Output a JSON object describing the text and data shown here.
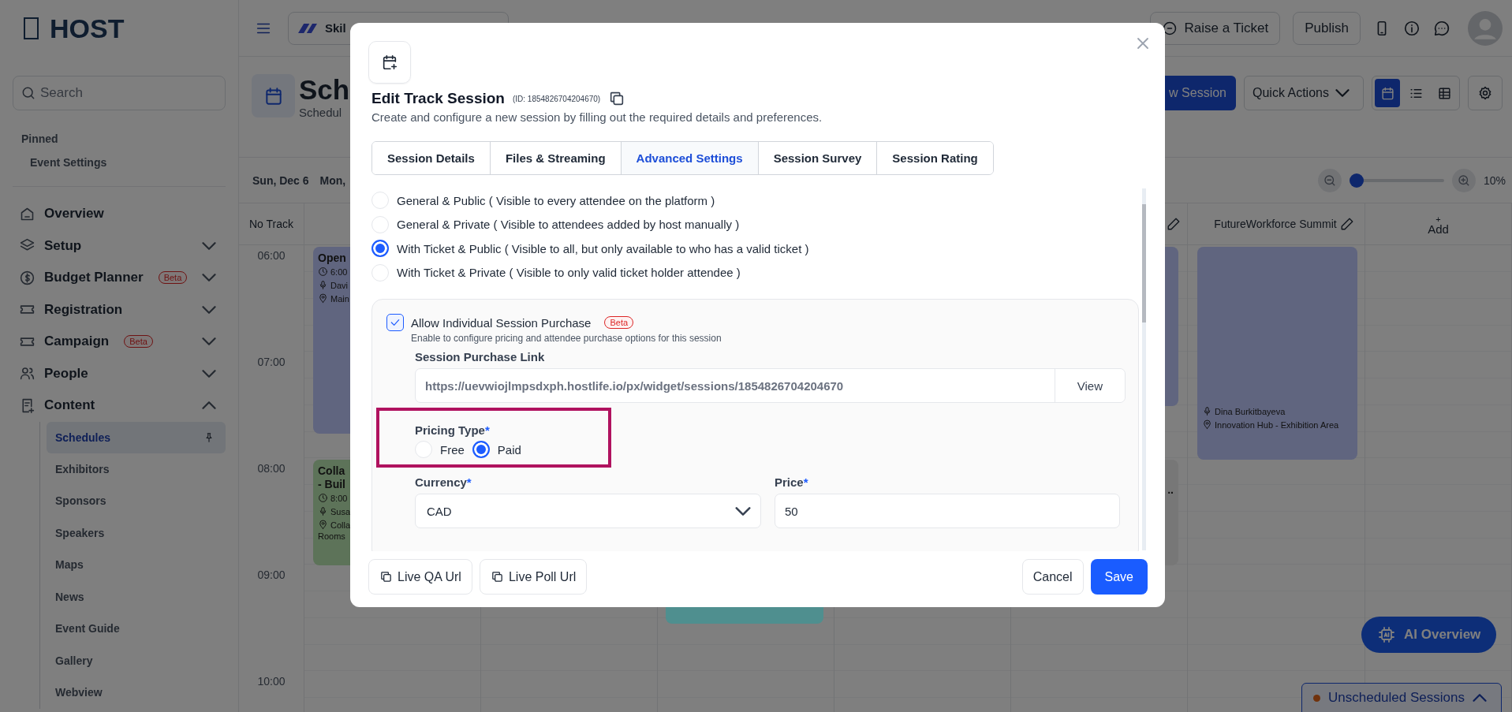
{
  "sidebar": {
    "logo": "HOST",
    "search": {
      "placeholder": "Search"
    },
    "pinned": {
      "heading": "Pinned",
      "items": [
        "Event Settings"
      ]
    },
    "nav": [
      {
        "label": "Overview"
      },
      {
        "label": "Setup",
        "expanded": false
      },
      {
        "label": "Budget Planner",
        "badge": "Beta",
        "expanded": false
      },
      {
        "label": "Registration",
        "expanded": false
      },
      {
        "label": "Campaign",
        "badge": "Beta",
        "expanded": false
      },
      {
        "label": "People",
        "expanded": false
      },
      {
        "label": "Content",
        "expanded": true,
        "children": [
          {
            "label": "Schedules",
            "selected": true,
            "pinned": true
          },
          {
            "label": "Exhibitors",
            "selected": false
          },
          {
            "label": "Sponsors",
            "selected": false
          },
          {
            "label": "Speakers",
            "selected": false
          },
          {
            "label": "Maps",
            "selected": false
          },
          {
            "label": "News",
            "selected": false
          },
          {
            "label": "Event Guide",
            "selected": false
          },
          {
            "label": "Gallery",
            "selected": false
          },
          {
            "label": "Webview",
            "selected": false
          }
        ]
      }
    ]
  },
  "topbar": {
    "event_selector": "Skil",
    "buttons": [
      "Raise a Ticket",
      "Publish"
    ]
  },
  "header": {
    "title": "Sch",
    "subtitle": "Schedul",
    "new_session_button": "w Session",
    "quick_actions": "Quick Actions",
    "views": [
      {
        "selected": true
      },
      {
        "selected": false
      },
      {
        "selected": false
      }
    ]
  },
  "date_bar": {
    "days": [
      "Sun, Dec 6",
      "Mon,"
    ],
    "zoom": {
      "level": 0,
      "reading": "10%"
    }
  },
  "calendar": {
    "corner": "No Track",
    "tracks": [
      {
        "editable": true
      },
      {
        "name": "FutureWorkforce Summit",
        "editable": true
      }
    ],
    "add_column": {
      "icon": "+",
      "label": "Add"
    },
    "hours": [
      "06:00",
      "07:00",
      "08:00",
      "09:00",
      "10:00"
    ],
    "events": [
      {
        "color": "#60657f",
        "title_lines": [
          "Open"
        ],
        "time": "6:00",
        "speaker": "Davi",
        "location_lines": [
          "Main"
        ]
      },
      {
        "color": "#5d7359",
        "title_lines": [
          "Colla",
          "- Buil"
        ],
        "time": "8:00",
        "speaker": "Susa",
        "location_lines": [
          "Colla",
          "Rooms"
        ]
      },
      {
        "color": "#60657f"
      },
      {
        "color": "#60657f",
        "speaker": "Dina Burkitbayeva",
        "location_lines": [
          "Innovation Hub - Exhibition Area"
        ]
      },
      {
        "color": "#777777",
        "title_lines": [
          ".."
        ]
      },
      {
        "color": "#4f8f8f"
      }
    ]
  },
  "ai_button": "AI Overview",
  "unscheduled": {
    "label": "Unscheduled Sessions",
    "expanded": false
  },
  "modal": {
    "title": "Edit Track Session",
    "id_label": "(ID: 1854826704204670)",
    "description": "Create and configure a new session by filling out the required details and preferences.",
    "tabs": [
      {
        "label": "Session Details",
        "selected": false
      },
      {
        "label": "Files & Streaming",
        "selected": false
      },
      {
        "label": "Advanced Settings",
        "selected": true
      },
      {
        "label": "Session Survey",
        "selected": false
      },
      {
        "label": "Session Rating",
        "selected": false
      }
    ],
    "visibility_options": [
      {
        "label": "General & Public ( Visible to every attendee on the platform )",
        "selected": false
      },
      {
        "label": "General & Private ( Visible to attendees added by host manually )",
        "selected": false
      },
      {
        "label": "With Ticket & Public ( Visible to all, but only available to who has a valid ticket )",
        "selected": true
      },
      {
        "label": "With Ticket & Private ( Visible to only valid ticket holder attendee )",
        "selected": false
      }
    ],
    "purchase": {
      "checked": true,
      "label": "Allow Individual Session Purchase",
      "badge": "Beta",
      "hint": "Enable to configure pricing and attendee purchase options for this session",
      "link_label": "Session Purchase Link",
      "link_value": "https://uevwiojlmpsdxph.hostlife.io/px/widget/sessions/1854826704204670",
      "view_button": "View"
    },
    "pricing": {
      "label": "Pricing Type",
      "required_mark": "*",
      "highlighted": true,
      "options": [
        {
          "label": "Free",
          "selected": false
        },
        {
          "label": "Paid",
          "selected": true
        }
      ]
    },
    "currency": {
      "label": "Currency",
      "required_mark": "*",
      "value": "CAD"
    },
    "price": {
      "label": "Price",
      "required_mark": "*",
      "value": "50"
    },
    "footer_left": [
      "Live QA Url",
      "Live Poll Url"
    ],
    "cancel_button": "Cancel",
    "save_button": "Save"
  }
}
